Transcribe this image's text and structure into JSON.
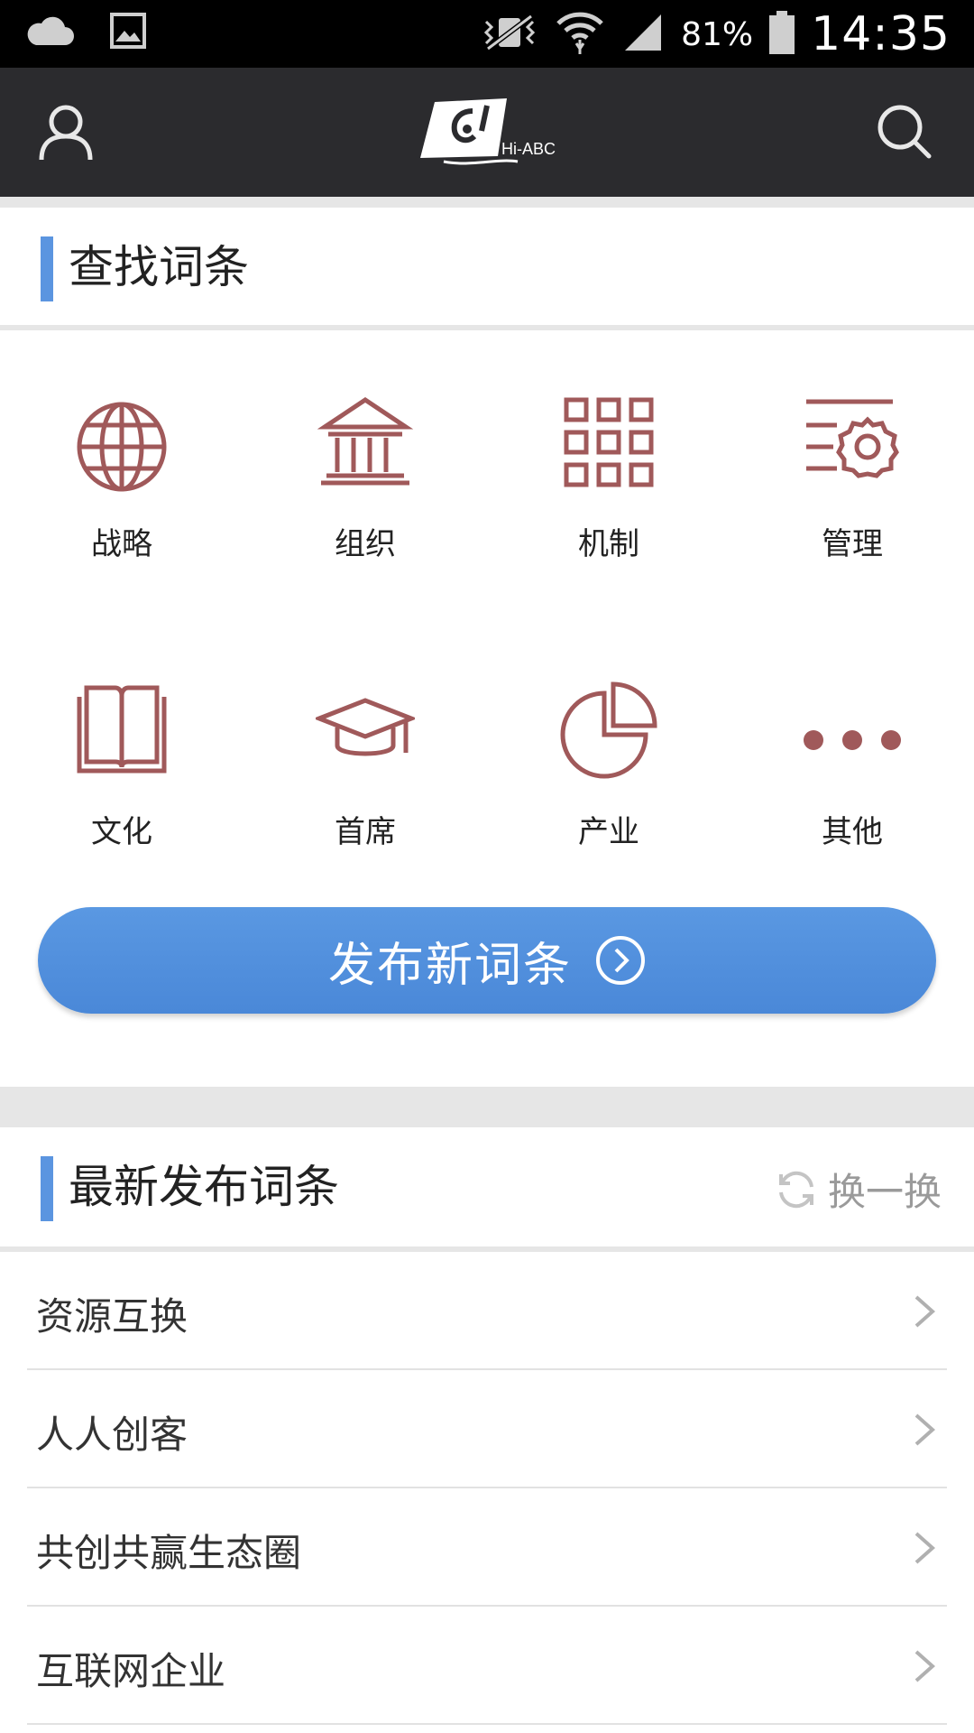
{
  "status_bar": {
    "battery_pct": "81%",
    "time": "14:35",
    "icons": [
      "cloud-icon",
      "image-icon",
      "vibrate-icon",
      "wifi-icon",
      "cell-signal-icon",
      "battery-icon"
    ]
  },
  "header": {
    "logo_text": "Hi-ABC",
    "icons": [
      "user-icon",
      "search-icon"
    ]
  },
  "search_section": {
    "title": "查找词条",
    "categories": [
      {
        "label": "战略",
        "icon": "globe-icon"
      },
      {
        "label": "组织",
        "icon": "institution-icon"
      },
      {
        "label": "机制",
        "icon": "grid-icon"
      },
      {
        "label": "管理",
        "icon": "settings-gear-icon"
      },
      {
        "label": "文化",
        "icon": "book-icon"
      },
      {
        "label": "首席",
        "icon": "graduation-cap-icon"
      },
      {
        "label": "产业",
        "icon": "pie-chart-icon"
      },
      {
        "label": "其他",
        "icon": "more-dots-icon"
      }
    ],
    "icon_color": "#a0595a"
  },
  "publish_button": {
    "label": "发布新词条",
    "color": "#4f8ede"
  },
  "latest_section": {
    "title": "最新发布词条",
    "refresh_label": "换一换",
    "items": [
      "资源互换",
      "人人创客",
      "共创共赢生态圈",
      "互联网企业"
    ]
  },
  "colors": {
    "accent": "#5b95e0",
    "header_bg": "#2b2b2e",
    "status_bg": "#000000"
  }
}
